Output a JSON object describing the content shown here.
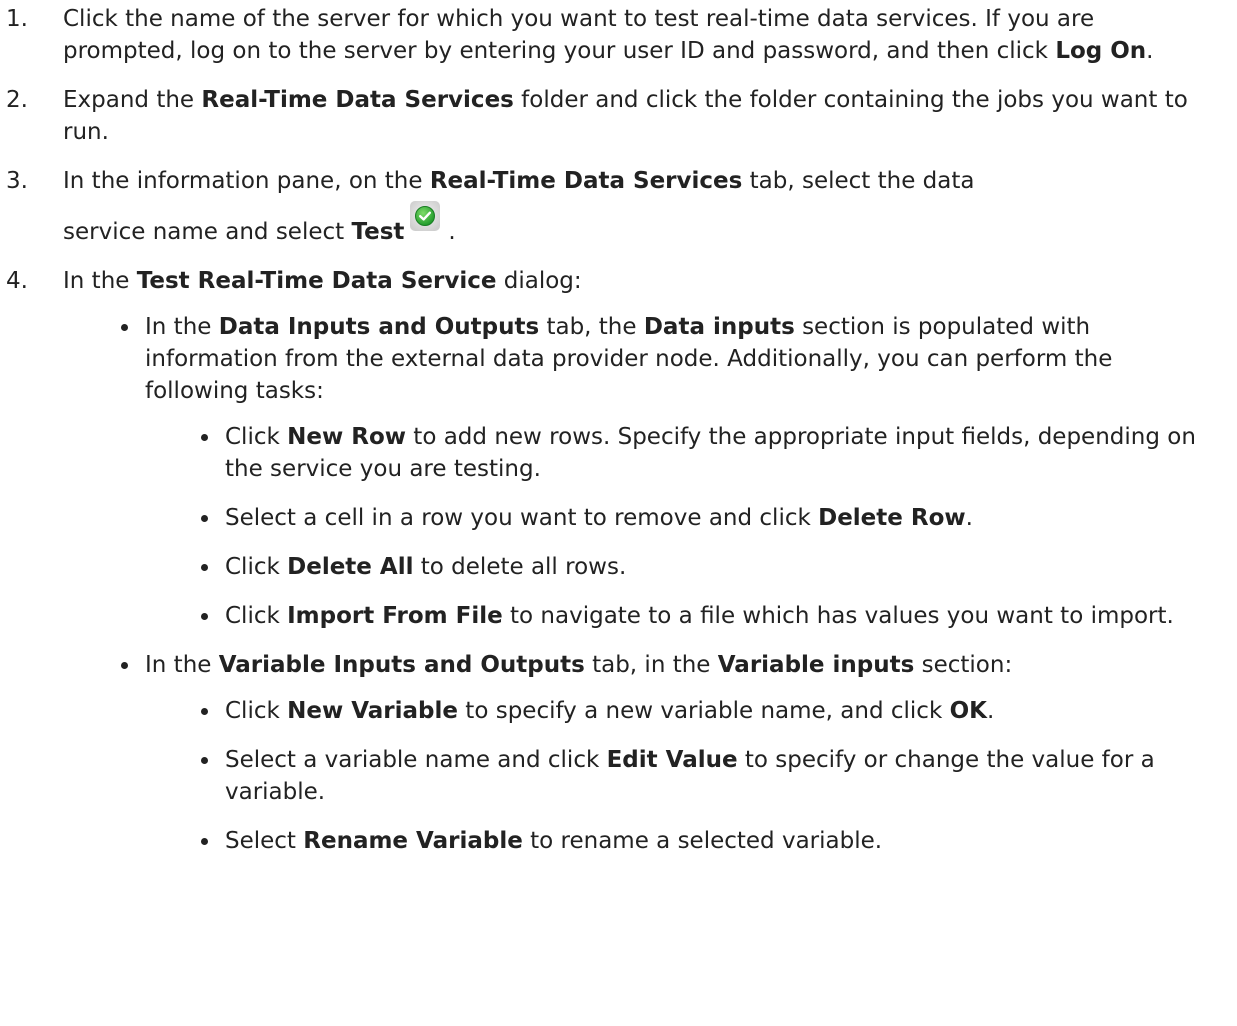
{
  "steps": [
    {
      "num": "1.",
      "t1": "Click the name of the server for which you want to test real-time data services. If you are prompted, log on to the server by entering your user ID and password, and then click ",
      "b1": "Log On",
      "t2": "."
    },
    {
      "num": "2.",
      "t1": "Expand the ",
      "b1": "Real-Time Data Services",
      "t2": " folder and click the folder containing the jobs you want to run."
    },
    {
      "num": "3.",
      "t1": "In the information pane, on the ",
      "b1": "Real-Time Data Services",
      "t2": " tab, select the data",
      "t3": "service name and select ",
      "b2": "Test",
      "t4": ".",
      "icon": "green-check-test-icon"
    },
    {
      "num": "4.",
      "t1": "In the ",
      "b1": "Test Real-Time Data Service",
      "t2": " dialog:",
      "bullets": [
        {
          "t1": "In the ",
          "b1": "Data Inputs and Outputs",
          "t2": " tab, the ",
          "b2": "Data inputs",
          "t3": " section is populated with information from the external data provider node. Additionally, you can perform the following tasks:",
          "items": [
            {
              "t1": "Click ",
              "b1": "New Row",
              "t2": " to add new rows. Specify the appropriate input fields, depending on the service you are testing."
            },
            {
              "t1": "Select a cell in a row you want to remove and click ",
              "b1": "Delete Row",
              "t2": "."
            },
            {
              "t1": "Click ",
              "b1": "Delete All",
              "t2": " to delete all rows."
            },
            {
              "t1": "Click ",
              "b1": "Import From File",
              "t2": " to navigate to a file which has values you want to import."
            }
          ]
        },
        {
          "t1": "In the ",
          "b1": "Variable Inputs and Outputs",
          "t2": " tab, in the ",
          "b2": "Variable inputs",
          "t3": " section:",
          "items": [
            {
              "t1": "Click ",
              "b1": "New Variable",
              "t2": " to specify a new variable name, and click ",
              "b2": "OK",
              "t3": "."
            },
            {
              "t1": "Select a variable name and click ",
              "b1": "Edit Value",
              "t2": " to specify or change the value for a variable."
            },
            {
              "t1": "Select ",
              "b1": "Rename Variable",
              "t2": " to rename a selected variable."
            }
          ]
        }
      ]
    }
  ]
}
